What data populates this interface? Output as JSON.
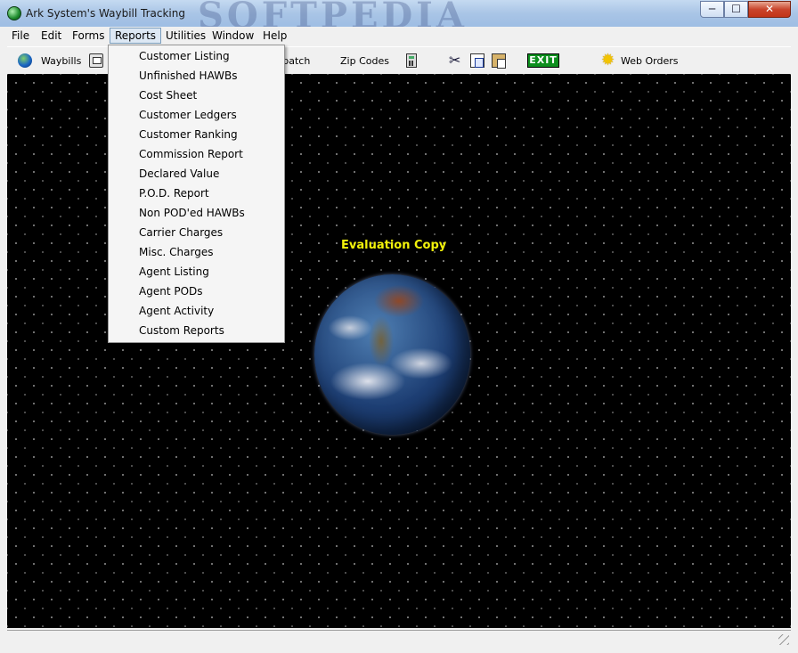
{
  "window": {
    "title": "Ark System's Waybill Tracking",
    "watermark": "SOFTPEDIA",
    "controls": {
      "minimize": "─",
      "maximize": "☐",
      "close": "✕"
    }
  },
  "menubar": {
    "items": [
      "File",
      "Edit",
      "Forms",
      "Reports",
      "Utilities",
      "Window",
      "Help"
    ],
    "open_menu": "Reports"
  },
  "toolbar": {
    "waybills_label": "Waybills",
    "dispatch_label": "Dispatch",
    "zip_codes_label": "Zip Codes",
    "exit_label": "EXIT",
    "web_orders_label": "Web Orders",
    "icons": [
      "globe-icon",
      "printer-icon",
      "calculator-icon",
      "scissors-icon",
      "copy-icon",
      "paste-icon",
      "sun-icon"
    ]
  },
  "reports_menu": {
    "items": [
      "Customer Listing",
      "Unfinished HAWBs",
      "Cost Sheet",
      "Customer Ledgers",
      "Customer Ranking",
      "Commission Report",
      "Declared Value",
      "P.O.D. Report",
      "Non POD'ed HAWBs",
      "Carrier Charges",
      "Misc. Charges",
      "Agent Listing",
      "Agent PODs",
      "Agent Activity",
      "Custom Reports"
    ]
  },
  "workspace": {
    "banner": "Evaluation Copy"
  },
  "colors": {
    "workspace_bg": "#000000",
    "banner_text": "#f2f20a",
    "exit_green": "#0d8f1e"
  }
}
